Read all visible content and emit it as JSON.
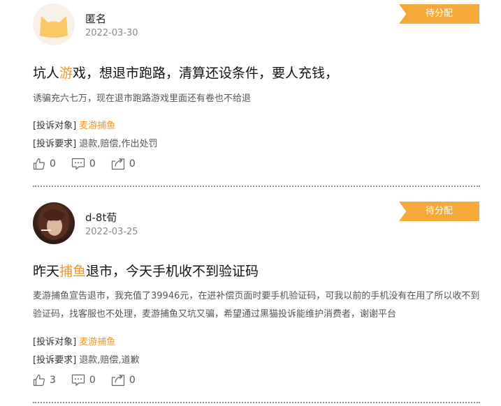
{
  "posts": [
    {
      "username": "匿名",
      "date": "2022-03-30",
      "status": "待分配",
      "title_before": "坑人",
      "title_highlight": "游",
      "title_after": "戏，想退市跑路，清算还设条件，要人充钱，",
      "body": "诱骗充六七万，现在退市跑路游戏里面还有卷也不给退",
      "target_label": "[投诉对象]",
      "target_value": "麦游捕鱼",
      "request_label": "[投诉要求]",
      "request_value": "退款,赔偿,作出处罚",
      "likes": "0",
      "comments": "0",
      "shares": "0"
    },
    {
      "username": "d-8t荀",
      "date": "2022-03-25",
      "status": "待分配",
      "title_before": "昨天",
      "title_highlight": "捕鱼",
      "title_after": "退市，今天手机收不到验证码",
      "body": "麦游捕鱼宣告退市，我充值了39946元，在进补偿页面时要手机验证码，可我以前的手机没有在用了所以收不到验证码，找客服也不处理，麦游捕鱼又坑又骗，希望通过黑猫投诉能维护消费者，谢谢平台",
      "target_label": "[投诉对象]",
      "target_value": "麦游捕鱼",
      "request_label": "[投诉要求]",
      "request_value": "退款,赔偿,道歉",
      "likes": "3",
      "comments": "0",
      "shares": "0"
    }
  ],
  "colors": {
    "accent": "#f0962b",
    "status_bg": "#f5a93b",
    "muted": "#8a8a8a"
  },
  "icons": {
    "anon_avatar": "cat-face-icon",
    "like": "thumbs-up-icon",
    "comment": "comment-icon",
    "share": "share-icon"
  }
}
